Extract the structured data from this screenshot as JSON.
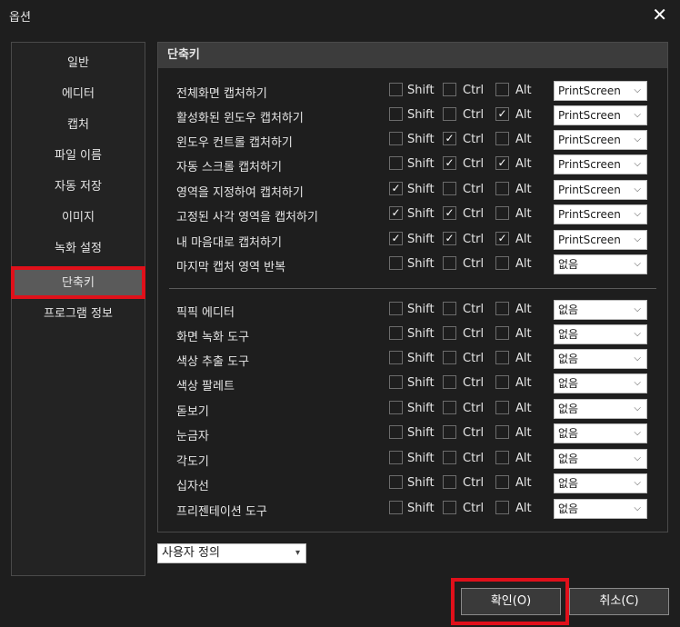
{
  "window": {
    "title": "옵션",
    "close_glyph": "✕"
  },
  "sidebar": {
    "items": [
      {
        "label": "일반"
      },
      {
        "label": "에디터"
      },
      {
        "label": "캡처"
      },
      {
        "label": "파일 이름"
      },
      {
        "label": "자동 저장"
      },
      {
        "label": "이미지"
      },
      {
        "label": "녹화 설정"
      },
      {
        "label": "단축키",
        "active": true
      },
      {
        "label": "프로그램 정보"
      }
    ]
  },
  "panel": {
    "header": "단축키",
    "modifiers": {
      "shift": "Shift",
      "ctrl": "Ctrl",
      "alt": "Alt"
    },
    "rows": [
      {
        "label": "전체화면 캡처하기",
        "shift": false,
        "ctrl": false,
        "alt": false,
        "key": "PrintScreen"
      },
      {
        "label": "활성화된 윈도우 캡처하기",
        "shift": false,
        "ctrl": false,
        "alt": true,
        "key": "PrintScreen"
      },
      {
        "label": "윈도우 컨트롤 캡처하기",
        "shift": false,
        "ctrl": true,
        "alt": false,
        "key": "PrintScreen"
      },
      {
        "label": "자동 스크롤 캡처하기",
        "shift": false,
        "ctrl": true,
        "alt": true,
        "key": "PrintScreen"
      },
      {
        "label": "영역을 지정하여 캡처하기",
        "shift": true,
        "ctrl": false,
        "alt": false,
        "key": "PrintScreen"
      },
      {
        "label": "고정된 사각 영역을 캡처하기",
        "shift": true,
        "ctrl": true,
        "alt": false,
        "key": "PrintScreen"
      },
      {
        "label": "내 마음대로 캡처하기",
        "shift": true,
        "ctrl": true,
        "alt": true,
        "key": "PrintScreen"
      },
      {
        "label": "마지막 캡처 영역 반복",
        "shift": false,
        "ctrl": false,
        "alt": false,
        "key": "없음"
      },
      {
        "label": "픽픽 에디터",
        "shift": false,
        "ctrl": false,
        "alt": false,
        "key": "없음"
      },
      {
        "label": "화면 녹화 도구",
        "shift": false,
        "ctrl": false,
        "alt": false,
        "key": "없음"
      },
      {
        "label": "색상 추출 도구",
        "shift": false,
        "ctrl": false,
        "alt": false,
        "key": "없음"
      },
      {
        "label": "색상 팔레트",
        "shift": false,
        "ctrl": false,
        "alt": false,
        "key": "없음"
      },
      {
        "label": "돋보기",
        "shift": false,
        "ctrl": false,
        "alt": false,
        "key": "없음"
      },
      {
        "label": "눈금자",
        "shift": false,
        "ctrl": false,
        "alt": false,
        "key": "없음"
      },
      {
        "label": "각도기",
        "shift": false,
        "ctrl": false,
        "alt": false,
        "key": "없음"
      },
      {
        "label": "십자선",
        "shift": false,
        "ctrl": false,
        "alt": false,
        "key": "없음"
      },
      {
        "label": "프리젠테이션 도구",
        "shift": false,
        "ctrl": false,
        "alt": false,
        "key": "없음"
      }
    ]
  },
  "preset": {
    "value": "사용자 정의"
  },
  "buttons": {
    "ok": "확인(O)",
    "cancel": "취소(C)"
  },
  "colors": {
    "highlight": "#e0101a",
    "active_item": "#5a5a5a",
    "header_bg": "#3c3c3c"
  }
}
